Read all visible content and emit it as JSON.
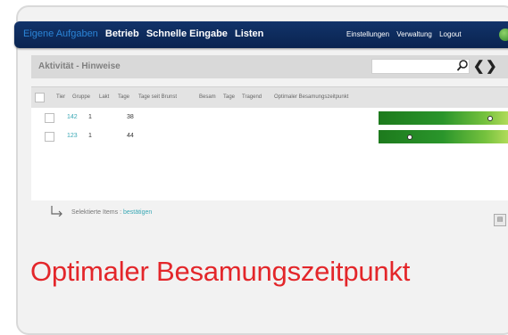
{
  "nav": {
    "active": "Eigene Aufgaben",
    "items": [
      "Betrieb",
      "Schnelle Eingabe",
      "Listen"
    ],
    "right_items": [
      "Einstellungen",
      "Verwaltung",
      "Logout"
    ]
  },
  "panel": {
    "title": "Aktivität - Hinweise",
    "search_value": ""
  },
  "table": {
    "columns": [
      "Tier",
      "Gruppe",
      "Lakt",
      "Tage",
      "Tage seit Brunst",
      "Besam",
      "Tage",
      "Tragend",
      "Optimaler Besamungszeitpunkt"
    ],
    "rows": [
      {
        "tier": "142",
        "gruppe": "1",
        "tage": "38",
        "marker": 0.78
      },
      {
        "tier": "123",
        "gruppe": "1",
        "tage": "44",
        "marker": 0.22
      }
    ]
  },
  "footer": {
    "label": "Selektierte Items :",
    "link": "bestätigen"
  },
  "caption": "Optimaler Besamungszeitpunkt",
  "colors": {
    "nav_bg": "#0a2450",
    "nav_active": "#2b84d6",
    "link": "#3aa8b5",
    "caption": "#e3262a",
    "bar_dark": "#1d7a1d",
    "bar_light": "#d4ea6a"
  },
  "icons": [
    "search-icon",
    "chevron-left-icon",
    "chevron-right-icon",
    "globe-icon",
    "arrow-return-icon",
    "export-icon"
  ]
}
